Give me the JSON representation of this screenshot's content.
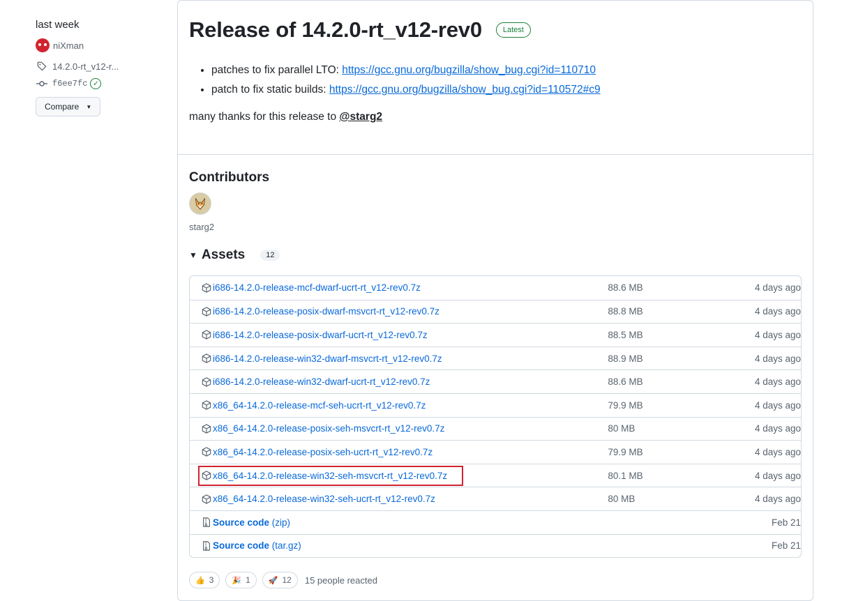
{
  "meta": {
    "date": "last week",
    "author": "niXman",
    "tag": "14.2.0-rt_v12-r...",
    "commit": "f6ee7fc",
    "compare_label": "Compare"
  },
  "release": {
    "title": "Release of 14.2.0-rt_v12-rev0",
    "latest_label": "Latest",
    "notes": [
      {
        "text": "patches to fix parallel LTO: ",
        "link": "https://gcc.gnu.org/bugzilla/show_bug.cgi?id=110710"
      },
      {
        "text": "patch to fix static builds: ",
        "link": "https://gcc.gnu.org/bugzilla/show_bug.cgi?id=110572#c9"
      }
    ],
    "thanks_text": "many thanks for this release to ",
    "thanks_mention": "@starg2"
  },
  "contributors": {
    "heading": "Contributors",
    "names": [
      "starg2"
    ]
  },
  "assets": {
    "heading": "Assets",
    "count": "12",
    "items": [
      {
        "name": "i686-14.2.0-release-mcf-dwarf-ucrt-rt_v12-rev0.7z",
        "size": "88.6 MB",
        "date": "4 days ago"
      },
      {
        "name": "i686-14.2.0-release-posix-dwarf-msvcrt-rt_v12-rev0.7z",
        "size": "88.8 MB",
        "date": "4 days ago"
      },
      {
        "name": "i686-14.2.0-release-posix-dwarf-ucrt-rt_v12-rev0.7z",
        "size": "88.5 MB",
        "date": "4 days ago"
      },
      {
        "name": "i686-14.2.0-release-win32-dwarf-msvcrt-rt_v12-rev0.7z",
        "size": "88.9 MB",
        "date": "4 days ago"
      },
      {
        "name": "i686-14.2.0-release-win32-dwarf-ucrt-rt_v12-rev0.7z",
        "size": "88.6 MB",
        "date": "4 days ago"
      },
      {
        "name": "x86_64-14.2.0-release-mcf-seh-ucrt-rt_v12-rev0.7z",
        "size": "79.9 MB",
        "date": "4 days ago"
      },
      {
        "name": "x86_64-14.2.0-release-posix-seh-msvcrt-rt_v12-rev0.7z",
        "size": "80 MB",
        "date": "4 days ago"
      },
      {
        "name": "x86_64-14.2.0-release-posix-seh-ucrt-rt_v12-rev0.7z",
        "size": "79.9 MB",
        "date": "4 days ago"
      },
      {
        "name": "x86_64-14.2.0-release-win32-seh-msvcrt-rt_v12-rev0.7z",
        "size": "80.1 MB",
        "date": "4 days ago"
      },
      {
        "name": "x86_64-14.2.0-release-win32-seh-ucrt-rt_v12-rev0.7z",
        "size": "80 MB",
        "date": "4 days ago"
      }
    ],
    "sources": [
      {
        "label": "Source code",
        "ext": "(zip)",
        "date": "Feb 21"
      },
      {
        "label": "Source code",
        "ext": "(tar.gz)",
        "date": "Feb 21"
      }
    ]
  },
  "reactions": {
    "items": [
      {
        "icon": "thumbs-up-icon",
        "emoji": "👍",
        "count": "3"
      },
      {
        "icon": "party-popper-icon",
        "emoji": "🎉",
        "count": "1"
      },
      {
        "icon": "rocket-icon",
        "emoji": "🚀",
        "count": "12"
      }
    ],
    "summary": "15 people reacted"
  },
  "colors": {
    "link": "#0969da",
    "latest_green": "#1a7f37",
    "highlight_red": "#d1242f",
    "border": "#d1d9e0"
  }
}
